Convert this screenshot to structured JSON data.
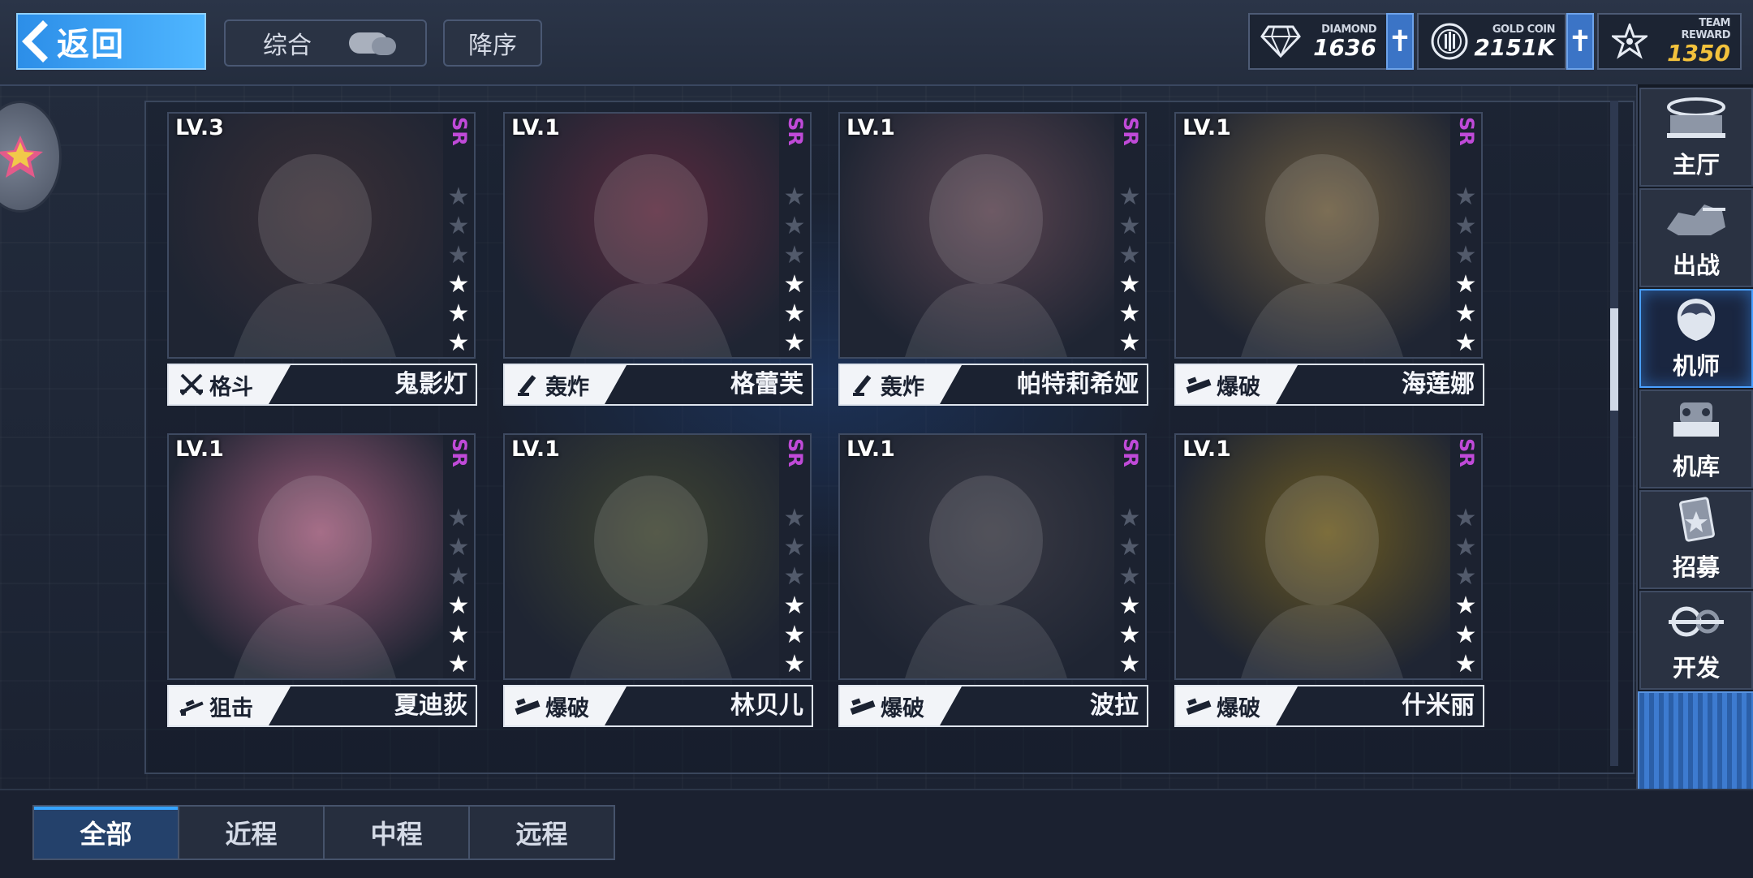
{
  "header": {
    "back_label": "返回",
    "sort_filter_label": "综合",
    "sort_order_label": "降序"
  },
  "resources": [
    {
      "label": "DIAMOND",
      "value": "1636",
      "icon": "diamond-icon"
    },
    {
      "label": "GOLD COIN",
      "value": "2151K",
      "icon": "gold-coin-icon"
    },
    {
      "label": "TEAM REWARD",
      "value": "1350",
      "icon": "team-reward-icon",
      "value_color": "#f3c23c"
    }
  ],
  "cards": [
    {
      "level": "LV.3",
      "rarity": "SR",
      "stars": 3,
      "role": "格斗",
      "role_icon": "melee-icon",
      "name": "鬼影灯",
      "art_color": "#3b2f36"
    },
    {
      "level": "LV.1",
      "rarity": "SR",
      "stars": 3,
      "role": "轰炸",
      "role_icon": "mortar-icon",
      "name": "格蕾芙",
      "art_color": "#5a2a3e"
    },
    {
      "level": "LV.1",
      "rarity": "SR",
      "stars": 3,
      "role": "轰炸",
      "role_icon": "mortar-icon",
      "name": "帕特莉希娅",
      "art_color": "#5a4450"
    },
    {
      "level": "LV.1",
      "rarity": "SR",
      "stars": 3,
      "role": "爆破",
      "role_icon": "blast-icon",
      "name": "海莲娜",
      "art_color": "#6a5a3e"
    },
    {
      "level": "LV.1",
      "rarity": "SR",
      "stars": 3,
      "role": "狙击",
      "role_icon": "sniper-icon",
      "name": "夏迪荻",
      "art_color": "#9a5a78"
    },
    {
      "level": "LV.1",
      "rarity": "SR",
      "stars": 3,
      "role": "爆破",
      "role_icon": "blast-icon",
      "name": "林贝儿",
      "art_color": "#3f4432"
    },
    {
      "level": "LV.1",
      "rarity": "SR",
      "stars": 3,
      "role": "爆破",
      "role_icon": "blast-icon",
      "name": "波拉",
      "art_color": "#3a3a44"
    },
    {
      "level": "LV.1",
      "rarity": "SR",
      "stars": 3,
      "role": "爆破",
      "role_icon": "blast-icon",
      "name": "什米丽",
      "art_color": "#6b5a22"
    }
  ],
  "side_nav": [
    {
      "label": "主厅",
      "icon": "lobby-icon",
      "active": false
    },
    {
      "label": "出战",
      "icon": "battle-icon",
      "active": false
    },
    {
      "label": "机师",
      "icon": "pilot-icon",
      "active": true
    },
    {
      "label": "机库",
      "icon": "hangar-icon",
      "active": false
    },
    {
      "label": "招募",
      "icon": "recruit-icon",
      "active": false
    },
    {
      "label": "开发",
      "icon": "develop-icon",
      "active": false
    }
  ],
  "range_tabs": [
    {
      "label": "全部",
      "active": true
    },
    {
      "label": "近程",
      "active": false
    },
    {
      "label": "中程",
      "active": false
    },
    {
      "label": "远程",
      "active": false
    }
  ],
  "colors": {
    "accent_blue": "#36a3ff",
    "rarity_purple": "#c04ad8",
    "team_reward_gold": "#f3c23c"
  }
}
